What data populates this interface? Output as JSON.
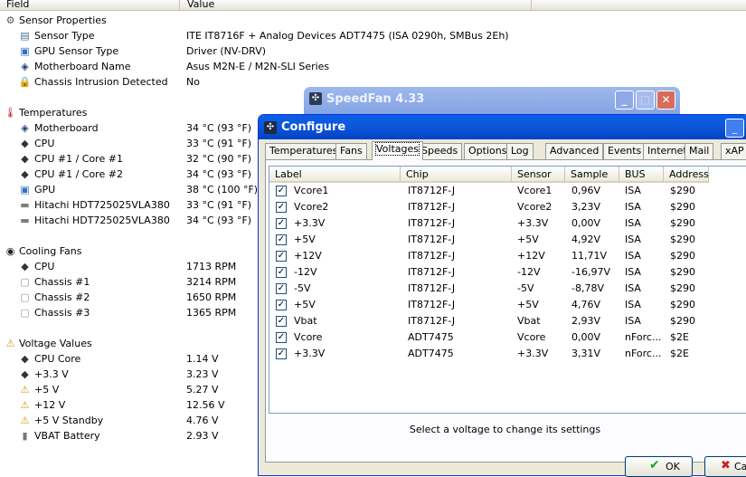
{
  "header": {
    "field": "Field",
    "value": "Value"
  },
  "sensors": [
    {
      "label": "Sensor Properties",
      "value": "",
      "icon": "sensor-props-icon",
      "indent": 0
    },
    {
      "label": "Sensor Type",
      "value": "ITE IT8716F + Analog Devices ADT7475  (ISA 0290h, SMBus 2Eh)",
      "icon": "chip-icon",
      "indent": 1
    },
    {
      "label": "GPU Sensor Type",
      "value": "Driver  (NV-DRV)",
      "icon": "gpu-icon",
      "indent": 1
    },
    {
      "label": "Motherboard Name",
      "value": "Asus M2N-E / M2N-SLI Series",
      "icon": "motherboard-icon",
      "indent": 1
    },
    {
      "label": "Chassis Intrusion Detected",
      "value": "No",
      "icon": "lock-icon",
      "indent": 1
    },
    {
      "label": "",
      "value": "",
      "icon": "",
      "indent": 0
    },
    {
      "label": "Temperatures",
      "value": "",
      "icon": "thermometer-icon",
      "indent": 0
    },
    {
      "label": "Motherboard",
      "value": "34 °C  (93 °F)",
      "icon": "motherboard-icon",
      "indent": 1
    },
    {
      "label": "CPU",
      "value": "33 °C  (91 °F)",
      "icon": "cpu-icon",
      "indent": 1
    },
    {
      "label": "CPU #1 / Core #1",
      "value": "32 °C  (90 °F)",
      "icon": "cpu-icon",
      "indent": 1
    },
    {
      "label": "CPU #1 / Core #2",
      "value": "34 °C  (93 °F)",
      "icon": "cpu-icon",
      "indent": 1
    },
    {
      "label": "GPU",
      "value": "38 °C  (100 °F)",
      "icon": "gpu-icon",
      "indent": 1
    },
    {
      "label": "Hitachi HDT725025VLA380",
      "value": "33 °C  (91 °F)",
      "icon": "hdd-icon",
      "indent": 1
    },
    {
      "label": "Hitachi HDT725025VLA380",
      "value": "34 °C  (93 °F)",
      "icon": "hdd-icon",
      "indent": 1
    },
    {
      "label": "",
      "value": "",
      "icon": "",
      "indent": 0
    },
    {
      "label": "Cooling Fans",
      "value": "",
      "icon": "fan-icon",
      "indent": 0
    },
    {
      "label": "CPU",
      "value": "1713 RPM",
      "icon": "cpu-icon",
      "indent": 1
    },
    {
      "label": "Chassis #1",
      "value": "3214 RPM",
      "icon": "chassis-icon",
      "indent": 1
    },
    {
      "label": "Chassis #2",
      "value": "1650 RPM",
      "icon": "chassis-icon",
      "indent": 1
    },
    {
      "label": "Chassis #3",
      "value": "1365 RPM",
      "icon": "chassis-icon",
      "indent": 1
    },
    {
      "label": "",
      "value": "",
      "icon": "",
      "indent": 0
    },
    {
      "label": "Voltage Values",
      "value": "",
      "icon": "voltage-icon",
      "indent": 0
    },
    {
      "label": "CPU Core",
      "value": "1.14 V",
      "icon": "cpu-icon",
      "indent": 1
    },
    {
      "label": "+3.3 V",
      "value": "3.23 V",
      "icon": "cpu-icon",
      "indent": 1
    },
    {
      "label": "+5 V",
      "value": "5.27 V",
      "icon": "voltage-icon",
      "indent": 1
    },
    {
      "label": "+12 V",
      "value": "12.56 V",
      "icon": "voltage-icon",
      "indent": 1
    },
    {
      "label": "+5 V Standby",
      "value": "4.76 V",
      "icon": "voltage-icon",
      "indent": 1
    },
    {
      "label": "VBAT Battery",
      "value": "2.93 V",
      "icon": "battery-icon",
      "indent": 1
    }
  ],
  "speedfan": {
    "title": "SpeedFan 4.33"
  },
  "configure": {
    "title": "Configure",
    "tabs": [
      "Temperatures",
      "Fans",
      "Voltages",
      "Speeds",
      "Options",
      "Log",
      "Advanced",
      "Events",
      "Internet",
      "Mail",
      "xAP"
    ],
    "active_tab": "Voltages",
    "columns": [
      "Label",
      "Chip",
      "Sensor",
      "Sample",
      "BUS",
      "Address"
    ],
    "rows": [
      {
        "checked": true,
        "label": "Vcore1",
        "chip": "IT8712F-J",
        "sensor": "Vcore1",
        "sample": "0,96V",
        "bus": "ISA",
        "address": "$290"
      },
      {
        "checked": true,
        "label": "Vcore2",
        "chip": "IT8712F-J",
        "sensor": "Vcore2",
        "sample": "3,23V",
        "bus": "ISA",
        "address": "$290"
      },
      {
        "checked": true,
        "label": "+3.3V",
        "chip": "IT8712F-J",
        "sensor": "+3.3V",
        "sample": "0,00V",
        "bus": "ISA",
        "address": "$290"
      },
      {
        "checked": true,
        "label": "+5V",
        "chip": "IT8712F-J",
        "sensor": "+5V",
        "sample": "4,92V",
        "bus": "ISA",
        "address": "$290"
      },
      {
        "checked": true,
        "label": "+12V",
        "chip": "IT8712F-J",
        "sensor": "+12V",
        "sample": "11,71V",
        "bus": "ISA",
        "address": "$290"
      },
      {
        "checked": true,
        "label": "-12V",
        "chip": "IT8712F-J",
        "sensor": "-12V",
        "sample": "-16,97V",
        "bus": "ISA",
        "address": "$290"
      },
      {
        "checked": true,
        "label": "-5V",
        "chip": "IT8712F-J",
        "sensor": "-5V",
        "sample": "-8,78V",
        "bus": "ISA",
        "address": "$290"
      },
      {
        "checked": true,
        "label": "+5V",
        "chip": "IT8712F-J",
        "sensor": "+5V",
        "sample": "4,76V",
        "bus": "ISA",
        "address": "$290"
      },
      {
        "checked": true,
        "label": "Vbat",
        "chip": "IT8712F-J",
        "sensor": "Vbat",
        "sample": "2,93V",
        "bus": "ISA",
        "address": "$290"
      },
      {
        "checked": true,
        "label": "Vcore",
        "chip": "ADT7475",
        "sensor": "Vcore",
        "sample": "0,00V",
        "bus": "nForc...",
        "address": "$2E"
      },
      {
        "checked": true,
        "label": "+3.3V",
        "chip": "ADT7475",
        "sensor": "+3.3V",
        "sample": "3,31V",
        "bus": "nForc...",
        "address": "$2E"
      }
    ],
    "hint": "Select a voltage to change its settings",
    "ok_label": "OK",
    "cancel_label": "Cancel"
  }
}
